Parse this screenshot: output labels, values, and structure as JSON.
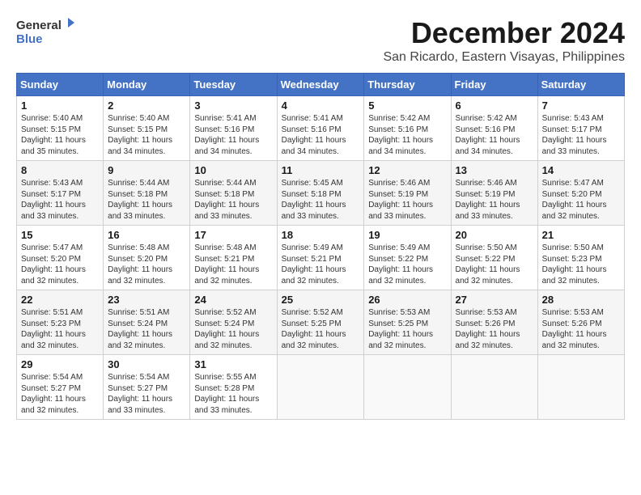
{
  "logo": {
    "line1": "General",
    "line2": "Blue"
  },
  "title": "December 2024",
  "location": "San Ricardo, Eastern Visayas, Philippines",
  "days_header": [
    "Sunday",
    "Monday",
    "Tuesday",
    "Wednesday",
    "Thursday",
    "Friday",
    "Saturday"
  ],
  "weeks": [
    [
      {
        "day": "1",
        "info": "Sunrise: 5:40 AM\nSunset: 5:15 PM\nDaylight: 11 hours\nand 35 minutes."
      },
      {
        "day": "2",
        "info": "Sunrise: 5:40 AM\nSunset: 5:15 PM\nDaylight: 11 hours\nand 34 minutes."
      },
      {
        "day": "3",
        "info": "Sunrise: 5:41 AM\nSunset: 5:16 PM\nDaylight: 11 hours\nand 34 minutes."
      },
      {
        "day": "4",
        "info": "Sunrise: 5:41 AM\nSunset: 5:16 PM\nDaylight: 11 hours\nand 34 minutes."
      },
      {
        "day": "5",
        "info": "Sunrise: 5:42 AM\nSunset: 5:16 PM\nDaylight: 11 hours\nand 34 minutes."
      },
      {
        "day": "6",
        "info": "Sunrise: 5:42 AM\nSunset: 5:16 PM\nDaylight: 11 hours\nand 34 minutes."
      },
      {
        "day": "7",
        "info": "Sunrise: 5:43 AM\nSunset: 5:17 PM\nDaylight: 11 hours\nand 33 minutes."
      }
    ],
    [
      {
        "day": "8",
        "info": "Sunrise: 5:43 AM\nSunset: 5:17 PM\nDaylight: 11 hours\nand 33 minutes."
      },
      {
        "day": "9",
        "info": "Sunrise: 5:44 AM\nSunset: 5:18 PM\nDaylight: 11 hours\nand 33 minutes."
      },
      {
        "day": "10",
        "info": "Sunrise: 5:44 AM\nSunset: 5:18 PM\nDaylight: 11 hours\nand 33 minutes."
      },
      {
        "day": "11",
        "info": "Sunrise: 5:45 AM\nSunset: 5:18 PM\nDaylight: 11 hours\nand 33 minutes."
      },
      {
        "day": "12",
        "info": "Sunrise: 5:46 AM\nSunset: 5:19 PM\nDaylight: 11 hours\nand 33 minutes."
      },
      {
        "day": "13",
        "info": "Sunrise: 5:46 AM\nSunset: 5:19 PM\nDaylight: 11 hours\nand 33 minutes."
      },
      {
        "day": "14",
        "info": "Sunrise: 5:47 AM\nSunset: 5:20 PM\nDaylight: 11 hours\nand 32 minutes."
      }
    ],
    [
      {
        "day": "15",
        "info": "Sunrise: 5:47 AM\nSunset: 5:20 PM\nDaylight: 11 hours\nand 32 minutes."
      },
      {
        "day": "16",
        "info": "Sunrise: 5:48 AM\nSunset: 5:20 PM\nDaylight: 11 hours\nand 32 minutes."
      },
      {
        "day": "17",
        "info": "Sunrise: 5:48 AM\nSunset: 5:21 PM\nDaylight: 11 hours\nand 32 minutes."
      },
      {
        "day": "18",
        "info": "Sunrise: 5:49 AM\nSunset: 5:21 PM\nDaylight: 11 hours\nand 32 minutes."
      },
      {
        "day": "19",
        "info": "Sunrise: 5:49 AM\nSunset: 5:22 PM\nDaylight: 11 hours\nand 32 minutes."
      },
      {
        "day": "20",
        "info": "Sunrise: 5:50 AM\nSunset: 5:22 PM\nDaylight: 11 hours\nand 32 minutes."
      },
      {
        "day": "21",
        "info": "Sunrise: 5:50 AM\nSunset: 5:23 PM\nDaylight: 11 hours\nand 32 minutes."
      }
    ],
    [
      {
        "day": "22",
        "info": "Sunrise: 5:51 AM\nSunset: 5:23 PM\nDaylight: 11 hours\nand 32 minutes."
      },
      {
        "day": "23",
        "info": "Sunrise: 5:51 AM\nSunset: 5:24 PM\nDaylight: 11 hours\nand 32 minutes."
      },
      {
        "day": "24",
        "info": "Sunrise: 5:52 AM\nSunset: 5:24 PM\nDaylight: 11 hours\nand 32 minutes."
      },
      {
        "day": "25",
        "info": "Sunrise: 5:52 AM\nSunset: 5:25 PM\nDaylight: 11 hours\nand 32 minutes."
      },
      {
        "day": "26",
        "info": "Sunrise: 5:53 AM\nSunset: 5:25 PM\nDaylight: 11 hours\nand 32 minutes."
      },
      {
        "day": "27",
        "info": "Sunrise: 5:53 AM\nSunset: 5:26 PM\nDaylight: 11 hours\nand 32 minutes."
      },
      {
        "day": "28",
        "info": "Sunrise: 5:53 AM\nSunset: 5:26 PM\nDaylight: 11 hours\nand 32 minutes."
      }
    ],
    [
      {
        "day": "29",
        "info": "Sunrise: 5:54 AM\nSunset: 5:27 PM\nDaylight: 11 hours\nand 32 minutes."
      },
      {
        "day": "30",
        "info": "Sunrise: 5:54 AM\nSunset: 5:27 PM\nDaylight: 11 hours\nand 33 minutes."
      },
      {
        "day": "31",
        "info": "Sunrise: 5:55 AM\nSunset: 5:28 PM\nDaylight: 11 hours\nand 33 minutes."
      },
      {
        "day": "",
        "info": ""
      },
      {
        "day": "",
        "info": ""
      },
      {
        "day": "",
        "info": ""
      },
      {
        "day": "",
        "info": ""
      }
    ]
  ]
}
